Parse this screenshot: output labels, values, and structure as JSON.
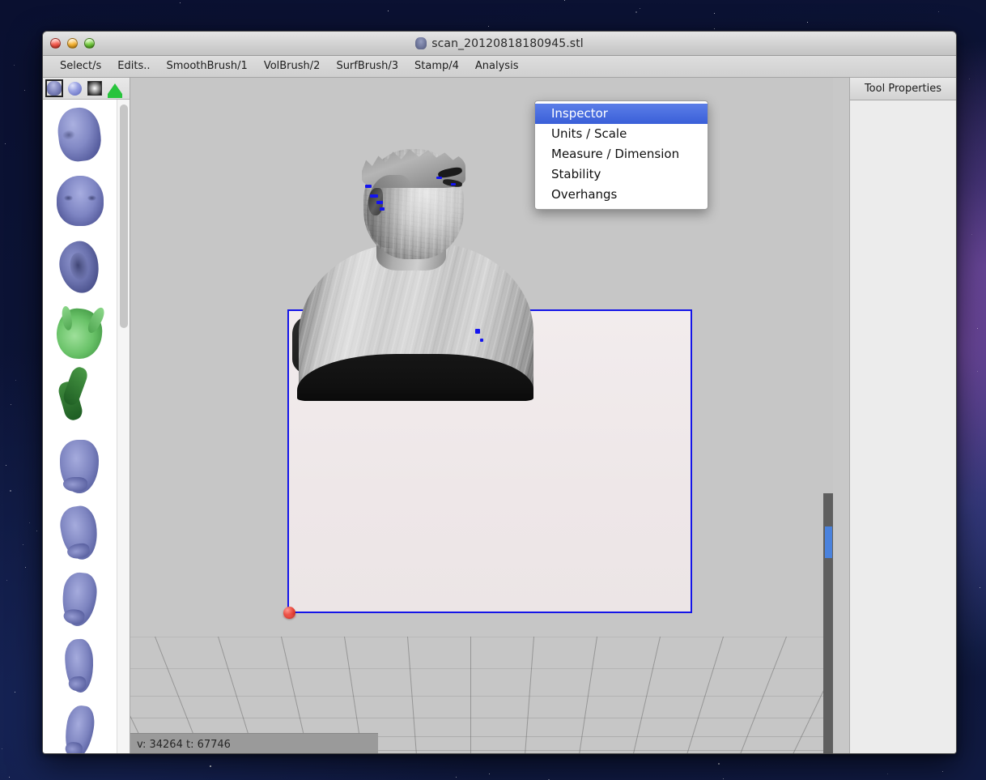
{
  "window": {
    "title": "scan_20120818180945.stl",
    "doc_icon": "mesh-document-icon",
    "traffic_lights": [
      {
        "name": "close-button",
        "label": "Close",
        "color": "#f4564a"
      },
      {
        "name": "minimize-button",
        "label": "Minimize",
        "color": "#f5b12e"
      },
      {
        "name": "maximize-button",
        "label": "Maximize",
        "color": "#6fc93a"
      }
    ]
  },
  "toolbar": {
    "items": [
      {
        "label": "Select/s",
        "name": "tab-selects"
      },
      {
        "label": "Edits..",
        "name": "tab-edits"
      },
      {
        "label": "SmoothBrush/1",
        "name": "tab-smoothbrush"
      },
      {
        "label": "VolBrush/2",
        "name": "tab-volbrush"
      },
      {
        "label": "SurfBrush/3",
        "name": "tab-surfbrush"
      },
      {
        "label": "Stamp/4",
        "name": "tab-stamp"
      },
      {
        "label": "Analysis",
        "name": "tab-analysis"
      }
    ]
  },
  "dropdown": {
    "open_for": "Analysis",
    "highlight_color": "#3a5fd8",
    "items": [
      {
        "label": "Inspector",
        "name": "menu-item-inspector",
        "selected": true
      },
      {
        "label": "Units / Scale",
        "name": "menu-item-units-scale",
        "selected": false
      },
      {
        "label": "Measure / Dimension",
        "name": "menu-item-measure-dimension",
        "selected": false
      },
      {
        "label": "Stability",
        "name": "menu-item-stability",
        "selected": false
      },
      {
        "label": "Overhangs",
        "name": "menu-item-overhangs",
        "selected": false
      }
    ]
  },
  "sidebar": {
    "mode_buttons": [
      {
        "name": "mode-head-icon",
        "label": "Head preview",
        "active": true
      },
      {
        "name": "mode-sphere-icon",
        "label": "Sphere preview",
        "active": false
      },
      {
        "name": "mode-gradient-icon",
        "label": "Gradient preview",
        "active": false
      },
      {
        "name": "mode-pentagon-icon",
        "label": "Solid preview",
        "active": false
      }
    ],
    "thumbnails": [
      {
        "name": "thumb-head-threequarter",
        "label": "Head 3/4"
      },
      {
        "name": "thumb-face-front",
        "label": "Face front"
      },
      {
        "name": "thumb-ear",
        "label": "Ear"
      },
      {
        "name": "thumb-hand-peace",
        "label": "Hand peace"
      },
      {
        "name": "thumb-hand-check",
        "label": "Hand check"
      },
      {
        "name": "thumb-limb-a",
        "label": "Limb A"
      },
      {
        "name": "thumb-limb-b",
        "label": "Limb B"
      },
      {
        "name": "thumb-limb-c",
        "label": "Limb C"
      },
      {
        "name": "thumb-limb-d",
        "label": "Limb D"
      },
      {
        "name": "thumb-limb-e",
        "label": "Limb E"
      }
    ]
  },
  "viewport": {
    "model_name": "scanned-bust-mesh",
    "bed_border_color": "#1414e8",
    "bed_fill_color": "#f0eaeb",
    "background_color": "#c6c6c6",
    "origin_marker": "origin-sphere-red",
    "error_marker_color": "#1414f0",
    "scrollbar_thumb_color": "#4a82dd"
  },
  "statusbar": {
    "text": "v: 34264 t: 67746"
  },
  "tool_panel": {
    "title": "Tool Properties"
  }
}
